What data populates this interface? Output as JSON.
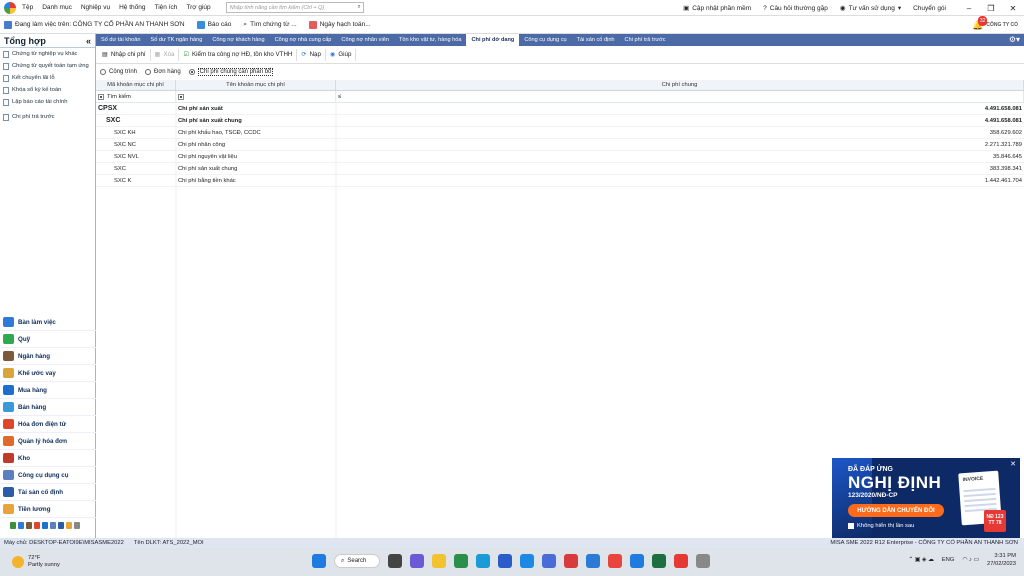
{
  "menubar": {
    "items": [
      "Tệp",
      "Danh mục",
      "Nghiệp vụ",
      "Hệ thống",
      "Tiện ích",
      "Trợ giúp"
    ],
    "search_placeholder": "Nhập tính năng cần tìm kiếm (Ctrl + Q)",
    "right": [
      "Cập nhật phần mềm",
      "Câu hỏi thường gặp",
      "Tư vấn sử dụng",
      "Chuyển gói"
    ]
  },
  "toolbar2": {
    "workplace": "Đang làm việc trên: CÔNG TY CỔ PHẦN AN THANH SƠN",
    "report": "Báo cáo",
    "find_doc": "Tìm chứng từ ...",
    "accounting_date": "Ngày hạch toán...",
    "notification_count": "32",
    "company_logo_text": "CÔNG TY CỔ"
  },
  "left_panel": {
    "title": "Tổng hợp",
    "collapse": "«",
    "items": [
      "Chứng từ nghiệp vụ khác",
      "Chứng từ quyết toán tạm ứng",
      "Kết chuyển lãi lỗ",
      "Khóa sổ kỳ kế toán",
      "Lập báo cáo tài chính",
      "Chi phí trả trước"
    ],
    "modules": [
      "Bàn làm việc",
      "Quỹ",
      "Ngân hàng",
      "Khế ước vay",
      "Mua hàng",
      "Bán hàng",
      "Hóa đơn điện tử",
      "Quản lý hóa đơn",
      "Kho",
      "Công cụ dụng cụ",
      "Tài sản cố định",
      "Tiền lương"
    ]
  },
  "tabs": [
    "Số dư tài khoản",
    "Số dư TK ngân hàng",
    "Công nợ khách hàng",
    "Công nợ nhà cung cấp",
    "Công nợ nhân viên",
    "Tồn kho vật tư, hàng hóa",
    "Chi phí dở dang",
    "Công cụ dụng cụ",
    "Tài sản cố định",
    "Chi phí trả trước"
  ],
  "active_tab": "Chi phí dở dang",
  "actions": {
    "import": "Nhập chi phí",
    "delete": "Xóa",
    "check": "Kiểm tra công nợ HĐ, tồn kho VTHH",
    "load": "Nạp",
    "help": "Giúp"
  },
  "radios": [
    "Công trình",
    "Đơn hàng",
    "Chi phí chung cần phân bổ"
  ],
  "radio_selected": "Chi phí chung cần phân bổ",
  "grid": {
    "headers": [
      "Mã khoản mục chi phí",
      "Tên khoản mục chi phí",
      "Chi phí chung"
    ],
    "filter_label": "Tìm kiếm",
    "filter_op": "≤",
    "rows": [
      {
        "code": "CPSX",
        "name": "Chi phí sản xuất",
        "amount": "4.491.658.081",
        "level": 0
      },
      {
        "code": "SXC",
        "name": "Chi phí sản xuất chung",
        "amount": "4.491.658.081",
        "level": 1
      },
      {
        "code": "SXC KH",
        "name": "Chi phí khấu hao, TSCĐ, CCDC",
        "amount": "358.629.602",
        "level": 2
      },
      {
        "code": "SXC NC",
        "name": "Chi phí nhân công",
        "amount": "2.271.321.789",
        "level": 2
      },
      {
        "code": "SXC NVL",
        "name": "Chi phí nguyên vật liệu",
        "amount": "35.846.645",
        "level": 2
      },
      {
        "code": "SXC",
        "name": "Chi phí sản xuất chung",
        "amount": "383.398.341",
        "level": 2
      },
      {
        "code": "SXC K",
        "name": "Chi phí bằng tiền khác",
        "amount": "1.442.461.704",
        "level": 2
      }
    ]
  },
  "statusbar": {
    "machine": "Máy chủ: DESKTOP-EATOI9E\\MISASME2022",
    "db": "Tên DLKT: ATS_2022_MOI",
    "right": "MISA SME 2022 R12 Enterprise - CÔNG TY CỔ PHẦN AN THANH SƠN"
  },
  "ad": {
    "t1": "ĐÃ ĐÁP ỨNG",
    "t2": "NGHỊ ĐỊNH",
    "t3": "123/2020/NĐ-CP",
    "button": "HƯỚNG DẪN CHUYỂN ĐỔI",
    "checkbox": "Không hiển thị lần sau",
    "invoice": "INVOICE",
    "stamp": "NĐ 123 TT 78"
  },
  "taskbar": {
    "temp": "72°F",
    "weather": "Partly sunny",
    "search": "Search",
    "lang": "ENG",
    "time": "3:31 PM",
    "date": "27/02/2023"
  }
}
